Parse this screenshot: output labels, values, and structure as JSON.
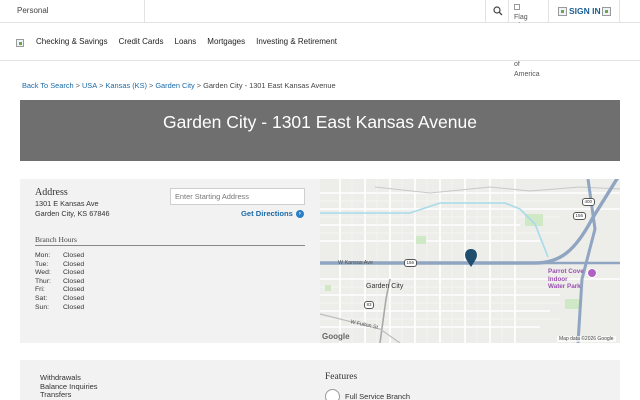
{
  "topbar": {
    "segment": "Personal",
    "flag_alt": "Flag of the United States of America",
    "sign_in": "SIGN IN"
  },
  "nav": {
    "items": [
      "Checking & Savings",
      "Credit Cards",
      "Loans",
      "Mortgages",
      "Investing & Retirement"
    ]
  },
  "breadcrumb": {
    "links": [
      "Back To Search",
      "USA",
      "Kansas (KS)",
      "Garden City"
    ],
    "current": "Garden City - 1301 East Kansas Avenue",
    "separator": ">"
  },
  "hero": {
    "title": "Garden City - 1301 East Kansas Avenue"
  },
  "address": {
    "title": "Address",
    "line1": "1301 E Kansas Ave",
    "line2": "Garden City, KS 67846"
  },
  "directions": {
    "placeholder": "Enter Starting Address",
    "button": "Get Directions",
    "icon": "arrow-right-icon"
  },
  "hours": {
    "title": "Branch Hours",
    "rows": [
      {
        "day": "Mon:",
        "value": "Closed"
      },
      {
        "day": "Tue:",
        "value": "Closed"
      },
      {
        "day": "Wed:",
        "value": "Closed"
      },
      {
        "day": "Thur:",
        "value": "Closed"
      },
      {
        "day": "Fri:",
        "value": "Closed"
      },
      {
        "day": "Sat:",
        "value": "Closed"
      },
      {
        "day": "Sun:",
        "value": "Closed"
      }
    ]
  },
  "map": {
    "city_label": "Garden City",
    "street_main": "W Kansas Ave",
    "street_south": "W Fulton St",
    "shields": [
      "156",
      "156",
      "400",
      "83"
    ],
    "poi": "Parrot Cove Indoor Water Park",
    "google": "Google",
    "attribution": "Map data ©2026 Google",
    "pin_color": "#1f4e6e"
  },
  "services": {
    "items": [
      "Withdrawals",
      "Balance Inquiries",
      "Transfers"
    ]
  },
  "features": {
    "title": "Features",
    "items": [
      "Full Service Branch"
    ]
  },
  "colors": {
    "link": "#1a6aa8",
    "hero_bg": "#6f6f6f",
    "panel_bg": "#f2f2f2"
  }
}
